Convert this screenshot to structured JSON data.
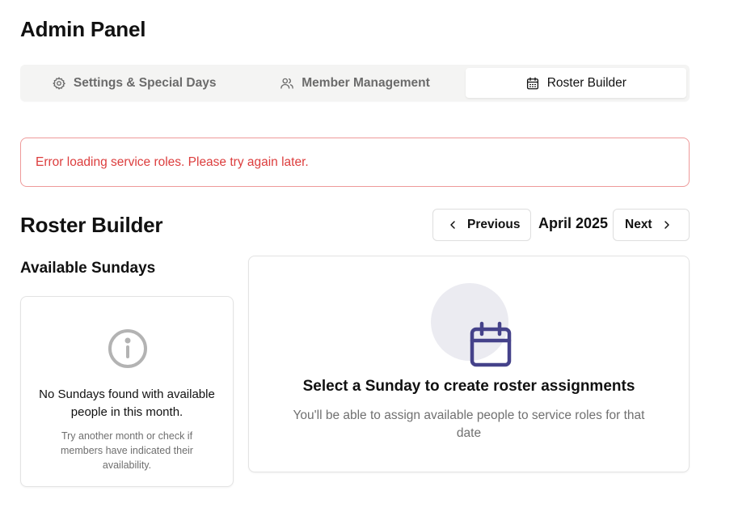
{
  "page_title": "Admin Panel",
  "tabs": [
    {
      "label": "Settings & Special Days",
      "icon": "gear-icon",
      "active": false
    },
    {
      "label": "Member Management",
      "icon": "users-icon",
      "active": false
    },
    {
      "label": "Roster Builder",
      "icon": "calendar-icon",
      "active": true
    }
  ],
  "error": {
    "message": "Error loading service roles. Please try again later."
  },
  "roster": {
    "title": "Roster Builder",
    "prev_label": "Previous",
    "next_label": "Next",
    "month": "April 2025"
  },
  "available": {
    "title": "Available Sundays",
    "empty_message": "No Sundays found with available people in this month.",
    "empty_hint": "Try another month or check if members have indicated their availability."
  },
  "assignment": {
    "title": "Select a Sunday to create roster assignments",
    "hint": "You'll be able to assign available people to service roles for that date"
  },
  "colors": {
    "error": "#dc3d3d",
    "error_border": "#ee9a9a",
    "calendar_accent": "#45428a",
    "tabs_bg": "#f4f4f3"
  }
}
